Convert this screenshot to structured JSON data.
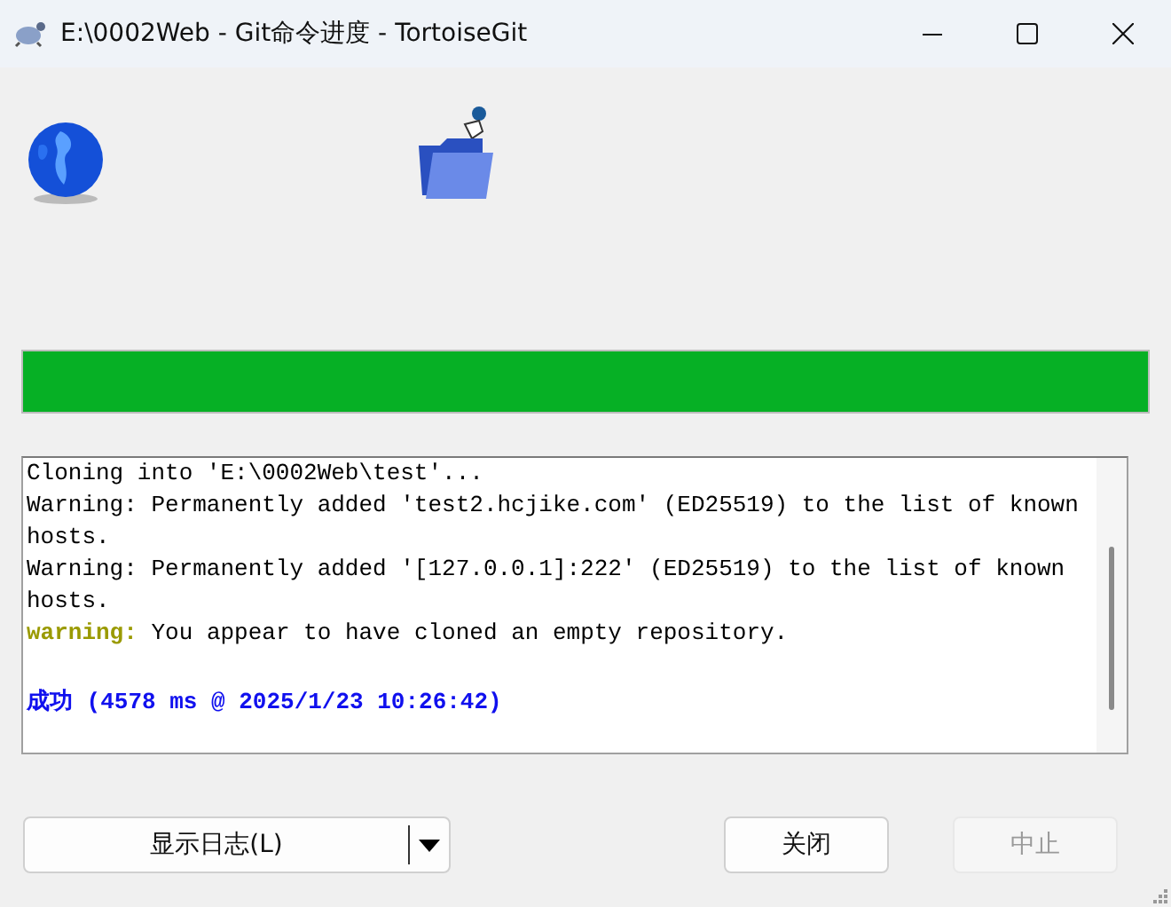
{
  "window": {
    "title": "E:\\0002Web - Git命令进度 - TortoiseGit"
  },
  "progress": {
    "level": 1
  },
  "log": [
    {
      "kind": "plain",
      "text": "Cloning into 'E:\\0002Web\\test'..."
    },
    {
      "kind": "plain",
      "text": "Warning: Permanently added 'test2.hcjike.com' (ED25519) to the list of known hosts."
    },
    {
      "kind": "plain",
      "text": "Warning: Permanently added '[127.0.0.1]:222' (ED25519) to the list of known hosts."
    },
    {
      "kind": "warning",
      "prefix": "warning:",
      "text": "You appear to have cloned an empty repository."
    },
    {
      "kind": "blank"
    },
    {
      "kind": "success",
      "text": "成功 (4578 ms @ 2025/1/23 10:26:42)"
    }
  ],
  "buttons": [
    {
      "label": "显示日志(L)",
      "kind": "split",
      "disabled": false
    },
    {
      "label": "关闭",
      "kind": "plain",
      "disabled": false
    },
    {
      "label": "中止",
      "kind": "plain",
      "disabled": true
    }
  ]
}
